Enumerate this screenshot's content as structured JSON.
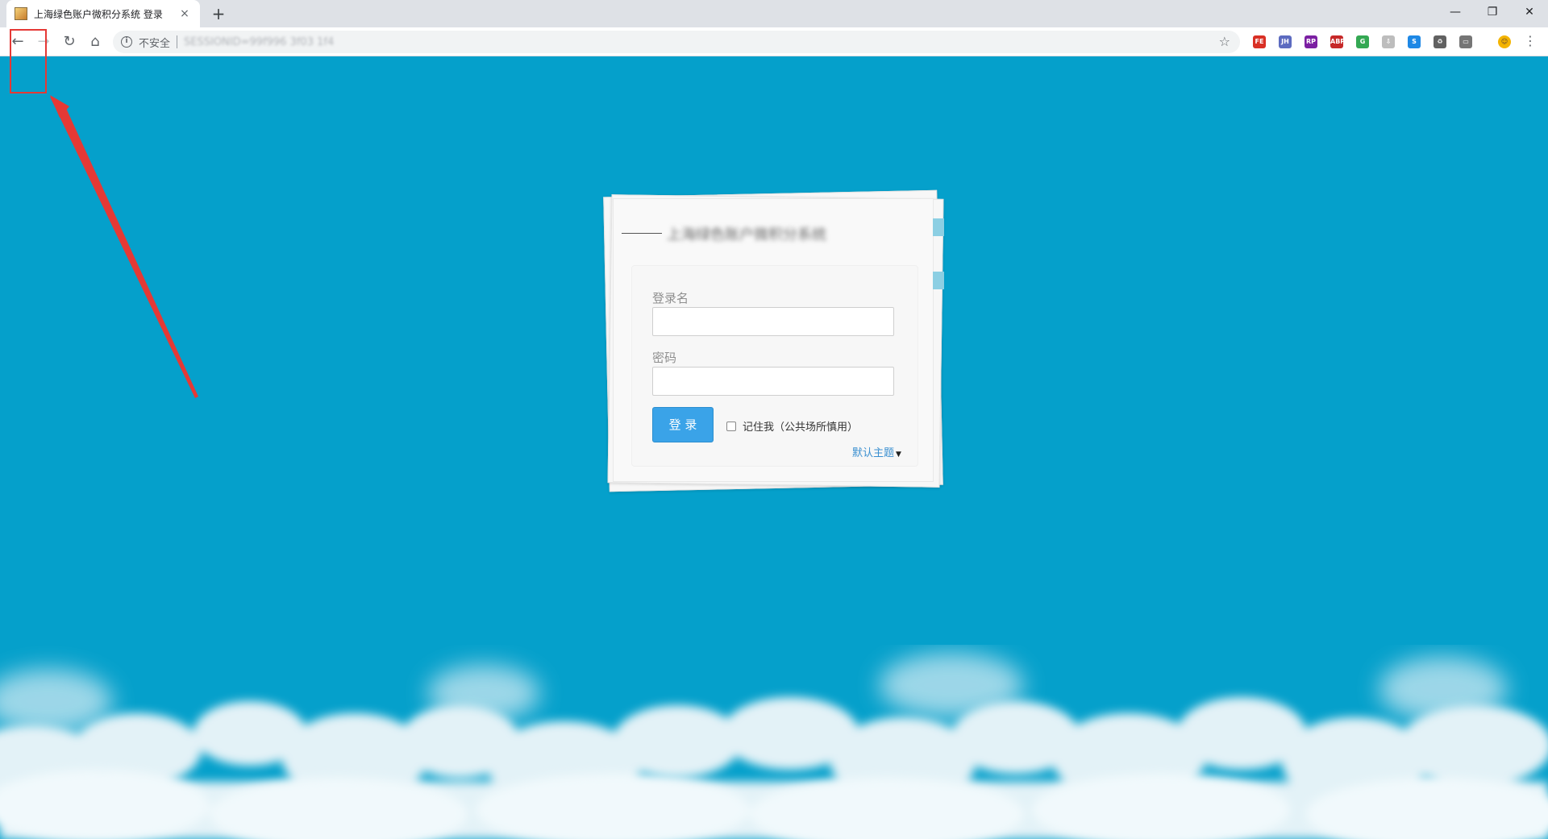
{
  "browser": {
    "tab_title": "上海绿色账户微积分系统 登录",
    "tab_close": "×",
    "new_tab": "+",
    "window_controls": {
      "minimize": "—",
      "restore": "❐",
      "close": "✕"
    },
    "nav": {
      "back": "←",
      "forward": "→",
      "reload": "↻",
      "home": "⌂"
    },
    "security_label": "不安全",
    "url": "SESSIONID=99f996  3f03  1f4",
    "star": "☆",
    "extensions": [
      {
        "name": "fe-extension-icon",
        "text": "FE",
        "color": "#d93025"
      },
      {
        "name": "jh-extension-icon",
        "text": "JH",
        "color": "#5c6bc0"
      },
      {
        "name": "rp-extension-icon",
        "text": "RP",
        "color": "#7b1fa2"
      },
      {
        "name": "adblock-extension-icon",
        "text": "ABP",
        "color": "#c62828"
      },
      {
        "name": "google-extension-icon",
        "text": "G",
        "color": "#34a853"
      },
      {
        "name": "download-extension-icon",
        "text": "⇩",
        "color": "#bdbdbd"
      },
      {
        "name": "search-extension-icon",
        "text": "S",
        "color": "#1e88e5"
      },
      {
        "name": "recycle-extension-icon",
        "text": "♻",
        "color": "#616161"
      },
      {
        "name": "mirror-extension-icon",
        "text": "▭",
        "color": "#757575"
      },
      {
        "name": "profile-avatar-icon",
        "text": "☺",
        "color": "#f4b400"
      }
    ],
    "menu": "⋮"
  },
  "login": {
    "title": "上海绿色账户微积分系统",
    "username_label": "登录名",
    "username_value": "",
    "password_label": "密码",
    "password_value": "",
    "submit_label": "登 录",
    "remember_label": "记住我（公共场所慎用）",
    "theme_label": "默认主题",
    "theme_caret": "▼"
  }
}
